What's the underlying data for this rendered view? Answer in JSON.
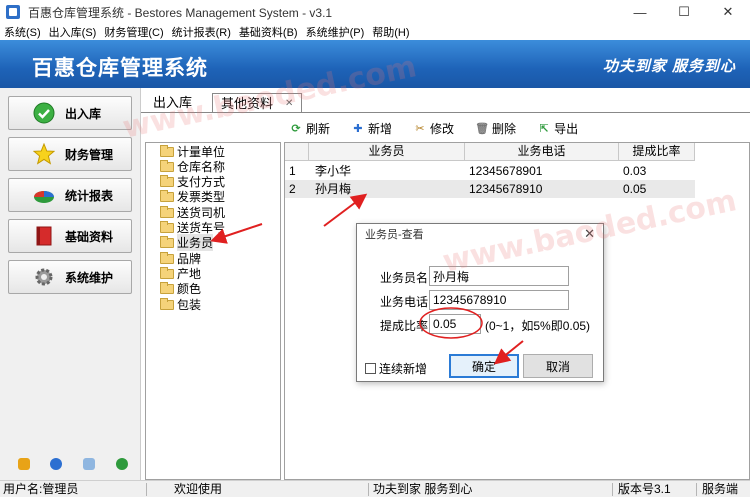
{
  "window": {
    "title": "百惠仓库管理系统 - Bestores Management System - v3.1",
    "controls": {
      "minimize": "—",
      "maximize": "☐",
      "close": "✕"
    }
  },
  "menu": [
    "系统(S)",
    "出入库(S)",
    "财务管理(C)",
    "统计报表(R)",
    "基础资料(B)",
    "系统维护(P)",
    "帮助(H)"
  ],
  "banner": {
    "title": "百惠仓库管理系统",
    "slogan": "功夫到家 服务到心"
  },
  "nav": [
    {
      "label": "出入库",
      "icon": "check-icon"
    },
    {
      "label": "财务管理",
      "icon": "star-icon"
    },
    {
      "label": "统计报表",
      "icon": "pie-chart-icon"
    },
    {
      "label": "基础资料",
      "icon": "book-icon"
    },
    {
      "label": "系统维护",
      "icon": "gear-icon"
    }
  ],
  "tabs": [
    {
      "label": "出入库"
    },
    {
      "label": "其他资料",
      "close": "✕"
    }
  ],
  "toolbar": {
    "refresh": "刷新",
    "add": "新增",
    "edit": "修改",
    "delete": "删除",
    "export": "导出"
  },
  "tree": [
    "计量单位",
    "仓库名称",
    "支付方式",
    "发票类型",
    "送货司机",
    "送货车号",
    "业务员",
    "品牌",
    "产地",
    "颜色",
    "包装"
  ],
  "grid": {
    "columns": [
      "",
      "业务员",
      "业务电话",
      "提成比率"
    ],
    "rows": [
      [
        "1",
        "李小华",
        "12345678901",
        "0.03"
      ],
      [
        "2",
        "孙月梅",
        "12345678910",
        "0.05"
      ]
    ]
  },
  "dialog": {
    "title": "业务员-查看",
    "close": "✕",
    "name_label": "业务员名",
    "name_value": "孙月梅",
    "phone_label": "业务电话",
    "phone_value": "12345678910",
    "rate_label": "提成比率",
    "rate_value": "0.05",
    "rate_hint": "(0~1，如5%即0.05)",
    "continuous_label": "连续新增",
    "ok": "确定",
    "cancel": "取消"
  },
  "status": {
    "user": "用户名:管理员",
    "welcome": "欢迎使用",
    "slogan": "功夫到家 服务到心",
    "version": "版本号3.1",
    "side": "服务端"
  },
  "watermark": "www.baoded.com",
  "colors": {
    "banner": "#1e63b8",
    "annotation": "#e02020",
    "primary_button_border": "#2b7bd6"
  }
}
